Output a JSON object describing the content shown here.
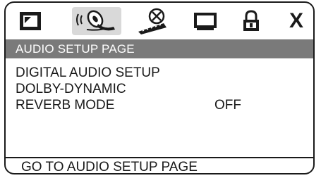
{
  "tabs": [
    {
      "name": "general-setup",
      "icon": "tv-screen-icon",
      "active": false
    },
    {
      "name": "audio-setup",
      "icon": "speaker-icon",
      "active": true
    },
    {
      "name": "video-setup",
      "icon": "film-reel-icon",
      "active": false
    },
    {
      "name": "preference",
      "icon": "monitor-icon",
      "active": false
    },
    {
      "name": "password",
      "icon": "padlock-icon",
      "active": false
    },
    {
      "name": "exit",
      "icon": "close-icon",
      "label": "X",
      "active": false
    }
  ],
  "header": {
    "title": "AUDIO SETUP PAGE"
  },
  "menu": {
    "items": [
      {
        "label": "DIGITAL AUDIO SETUP",
        "value": ""
      },
      {
        "label": "DOLBY-DYNAMIC",
        "value": ""
      },
      {
        "label": "REVERB MODE",
        "value": "OFF"
      }
    ]
  },
  "status": {
    "text": "GO TO AUDIO SETUP PAGE"
  }
}
